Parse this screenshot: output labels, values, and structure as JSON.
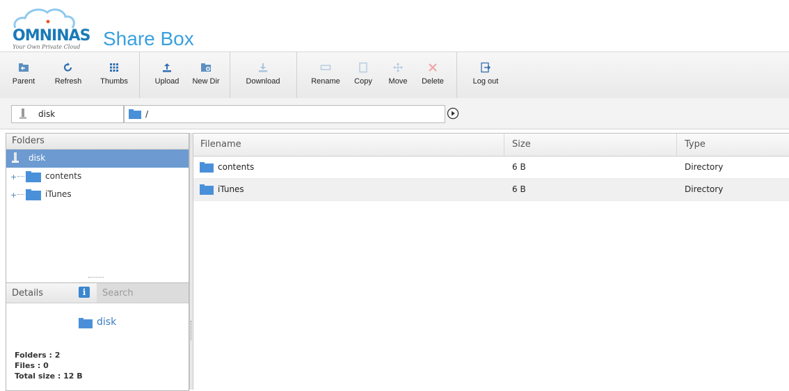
{
  "app": {
    "logo_text": "OMNINAS",
    "logo_tagline": "Your Own Private Cloud",
    "product": "Share Box"
  },
  "toolbar": {
    "parent": "Parent",
    "refresh": "Refresh",
    "thumbs": "Thumbs",
    "upload": "Upload",
    "new_dir": "New Dir",
    "download": "Download",
    "rename": "Rename",
    "copy": "Copy",
    "move": "Move",
    "delete": "Delete",
    "logout": "Log out"
  },
  "pathbar": {
    "drive": "disk",
    "path": "/"
  },
  "folders_panel": {
    "title": "Folders",
    "items": [
      {
        "label": "disk",
        "selected": true
      },
      {
        "label": "contents"
      },
      {
        "label": "iTunes"
      }
    ]
  },
  "details_panel": {
    "tab_details": "Details",
    "tab_info_icon": "i",
    "tab_search": "Search",
    "name": "disk",
    "stats": {
      "folders": "Folders : 2",
      "files": "Files : 0",
      "total_size": "Total size : 12 B"
    }
  },
  "file_grid": {
    "columns": [
      "Filename",
      "Size",
      "Type"
    ],
    "rows": [
      {
        "name": "contents",
        "size": "6 B",
        "type": "Directory"
      },
      {
        "name": "iTunes",
        "size": "6 B",
        "type": "Directory"
      }
    ]
  },
  "colors": {
    "accent": "#3aa0de",
    "selection": "#6c9ad1",
    "folder": "#4a90d9"
  }
}
